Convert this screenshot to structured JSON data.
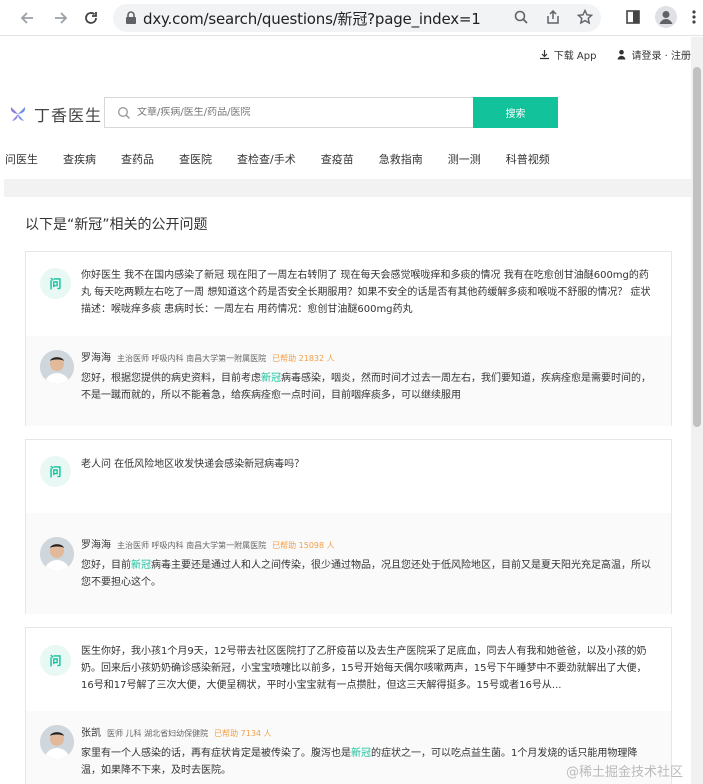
{
  "browser": {
    "url": "dxy.com/search/questions/新冠?page_index=1"
  },
  "topbar": {
    "download": "下载 App",
    "login": "请登录 · 注册"
  },
  "logo": {
    "text": "丁香医生"
  },
  "search": {
    "placeholder": "文章/疾病/医生/药品/医院",
    "button": "搜索"
  },
  "nav": [
    "问医生",
    "查疾病",
    "查药品",
    "查医院",
    "查检查/手术",
    "查疫苗",
    "急救指南",
    "测一测",
    "科普视频"
  ],
  "heading": "以下是“新冠”相关的公开问题",
  "qa": [
    {
      "badge": "问",
      "question": "你好医生 我不在国内感染了新冠 现在阳了一周左右转阴了 现在每天会感觉喉咙痒和多痰的情况 我有在吃愈创甘油醚600mg的药丸 每天吃两颗左右吃了一周 想知道这个药是否安全长期服用？如果不安全的话是否有其他药缓解多痰和喉咙不舒服的情况？ 症状描述：喉咙痒多痰 患病时长：一周左右 用药情况：愈创甘油醚600mg药丸",
      "doctor": "罗海海",
      "meta": "主治医师 呼吸内科 南昌大学第一附属医院",
      "helped": "已帮助 21832 人",
      "answer_pre": "您好，根据您提供的病史资料，目前考虑",
      "answer_hl": "新冠",
      "answer_post": "病毒感染，咽炎，然而时间才过去一周左右，我们要知道，疾病痊愈是需要时间的，不是一蹴而就的，所以不能着急，给疾病痊愈一点时间，目前咽痒痰多，可以继续服用"
    },
    {
      "badge": "问",
      "question": "老人问 在低风险地区收发快递会感染新冠病毒吗？",
      "doctor": "罗海海",
      "meta": "主治医师 呼吸内科 南昌大学第一附属医院",
      "helped": "已帮助 15098 人",
      "answer_pre": "您好，目前",
      "answer_hl": "新冠",
      "answer_post": "病毒主要还是通过人和人之间传染，很少通过物品，况且您还处于低风险地区，目前又是夏天阳光充足高温，所以您不要担心这个。"
    },
    {
      "badge": "问",
      "question": "医生你好，我小孩1个月9天，12号带去社区医院打了乙肝疫苗以及去生产医院采了足底血，同去人有我和她爸爸，以及小孩的奶奶。回来后小孩奶奶确诊感染新冠，小宝宝喷嚏比以前多，15号开始每天偶尔咳嗽两声，15号下午睡梦中不要劲就解出了大便，16号和17号解了三次大便，大便呈稠状，平时小宝宝就有一点攒肚，但这三天解得挺多。15号或者16号从...",
      "doctor": "张凯",
      "meta": "医师 儿科 湖北省妇幼保健院",
      "helped": "已帮助 7134 人",
      "answer_pre": "家里有一个人感染的话，再有症状肯定是被传染了。腹泻也是",
      "answer_hl": "新冠",
      "answer_post": "的症状之一，可以吃点益生菌。1个月发烧的话只能用物理降温，如果降不下来，及时去医院。"
    }
  ],
  "watermark": "@稀土掘金技术社区"
}
